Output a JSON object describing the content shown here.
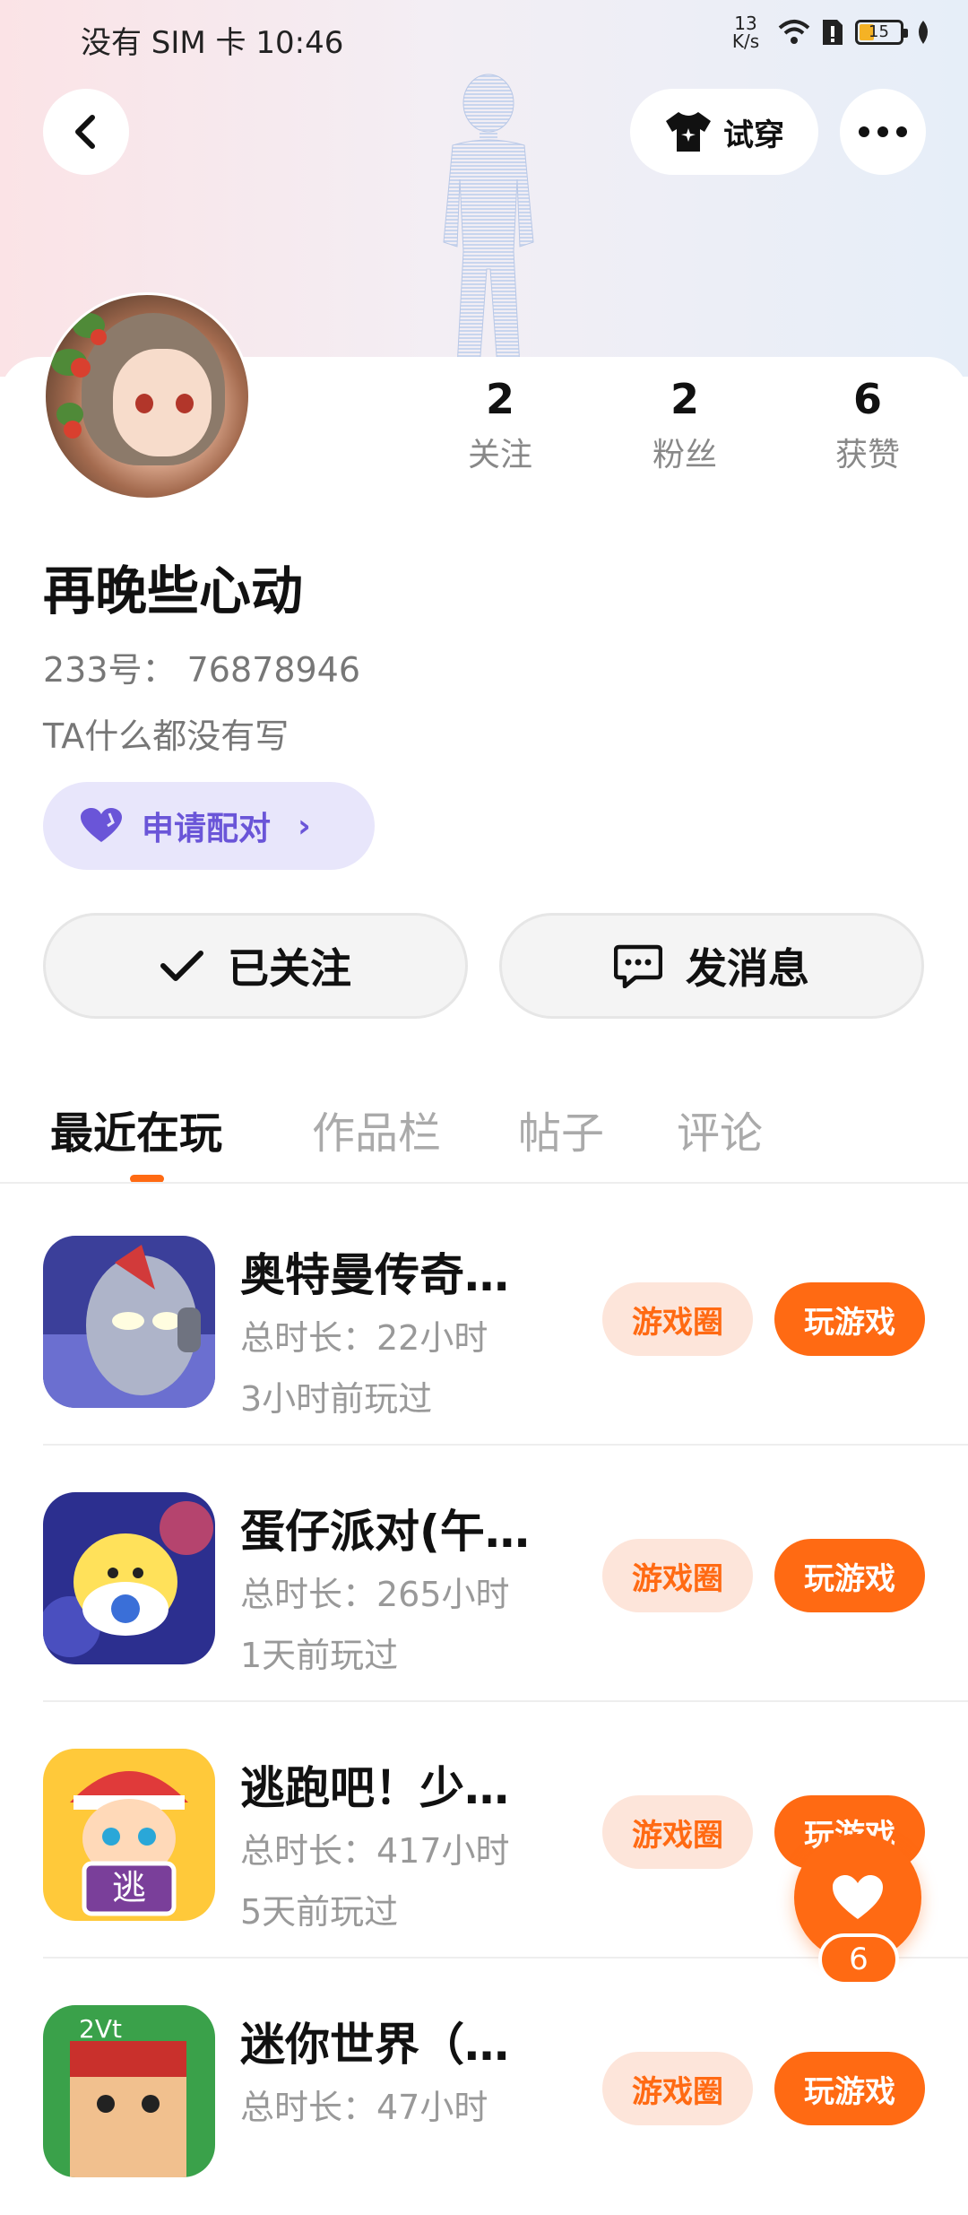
{
  "status_bar": {
    "left_text": "没有 SIM 卡 10:46",
    "net_speed_value": "13",
    "net_speed_unit": "K/s",
    "battery": "15"
  },
  "header": {
    "tryon_label": "试穿"
  },
  "profile": {
    "nickname": "再晚些心动",
    "uid": "233号： 76878946",
    "bio": "TA什么都没有写",
    "pair_label": "申请配对",
    "stats": [
      {
        "value": "2",
        "label": "关注"
      },
      {
        "value": "2",
        "label": "粉丝"
      },
      {
        "value": "6",
        "label": "获赞"
      }
    ],
    "follow_label": "已关注",
    "message_label": "发消息"
  },
  "tabs": [
    {
      "label": "最近在玩",
      "active": true
    },
    {
      "label": "作品栏",
      "active": false
    },
    {
      "label": "帖子",
      "active": false
    },
    {
      "label": "评论",
      "active": false
    }
  ],
  "games": [
    {
      "title": "奥特曼传奇…",
      "duration": "总时长：22小时",
      "last_played": "3小时前玩过",
      "icon": "ultraman-icon",
      "circle_label": "游戏圈",
      "play_label": "玩游戏"
    },
    {
      "title": "蛋仔派对(午…",
      "duration": "总时长：265小时",
      "last_played": "1天前玩过",
      "icon": "eggy-party-icon",
      "circle_label": "游戏圈",
      "play_label": "玩游戏"
    },
    {
      "title": "逃跑吧！少…",
      "duration": "总时长：417小时",
      "last_played": "5天前玩过",
      "icon": "escape-game-icon",
      "circle_label": "游戏圈",
      "play_label": "玩游戏"
    },
    {
      "title": "迷你世界（…",
      "duration": "总时长：47小时",
      "last_played": "",
      "icon": "mini-world-icon",
      "circle_label": "游戏圈",
      "play_label": "玩游戏"
    }
  ],
  "like_fab": {
    "count": "6"
  },
  "colors": {
    "accent": "#ff6a13",
    "pair_bg": "#e8e6fb",
    "pair_text": "#6a55d8"
  }
}
